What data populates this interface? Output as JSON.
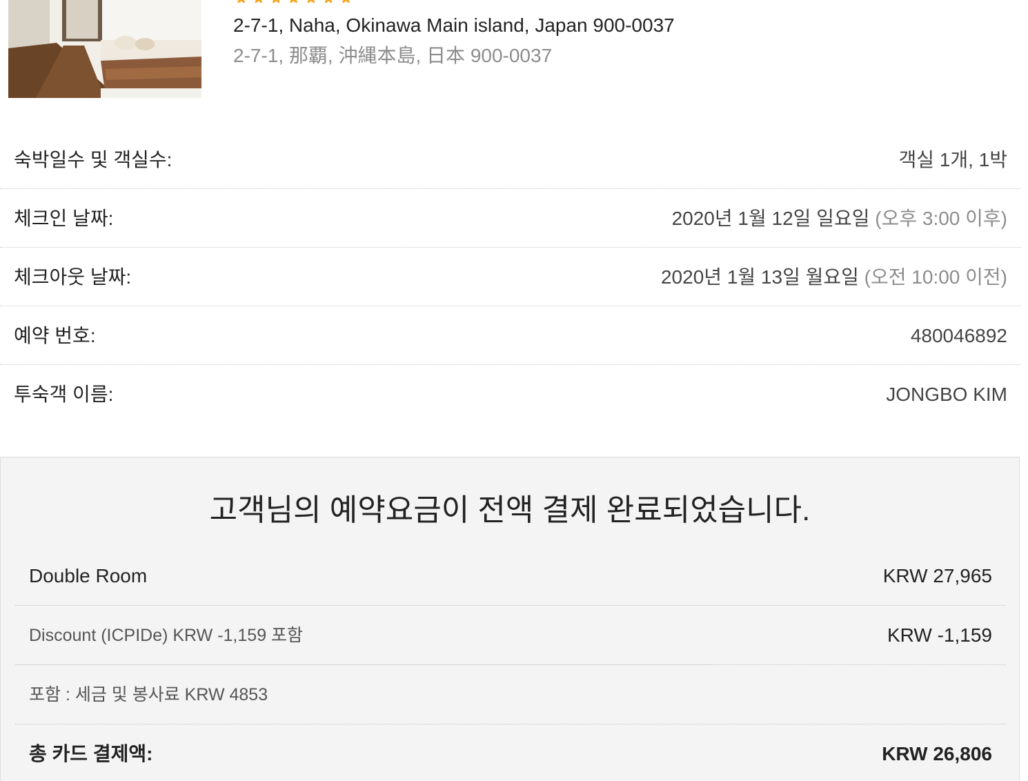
{
  "hotel": {
    "stars_display": "★★★★★★★",
    "address_en": "2-7-1, Naha, Okinawa Main island, Japan 900-0037",
    "address_local": "2-7-1, 那覇, 沖縄本島, 日本 900-0037"
  },
  "booking_details": [
    {
      "label": "숙박일수 및 객실수:",
      "value": "객실 1개, 1박",
      "note": ""
    },
    {
      "label": "체크인 날짜:",
      "value": "2020년 1월 12일 일요일",
      "note": "(오후 3:00 이후)"
    },
    {
      "label": "체크아웃 날짜:",
      "value": "2020년 1월 13일 월요일",
      "note": "(오전 10:00 이전)"
    },
    {
      "label": "예약 번호:",
      "value": "480046892",
      "note": ""
    },
    {
      "label": "투숙객 이름:",
      "value": "JONGBO KIM",
      "note": ""
    }
  ],
  "payment": {
    "title": "고객님의 예약요금이 전액 결제 완료되었습니다.",
    "room_label": "Double Room",
    "room_price": "KRW 27,965",
    "discount_label": "Discount (ICPIDe) KRW -1,159 포함",
    "discount_value": "KRW -1,159",
    "tax_label": "포함 : 세금 및 봉사료 KRW 4853",
    "total_label": "총 카드 결제액:",
    "total_value": "KRW 26,806"
  },
  "colors": {
    "star": "#f6a623",
    "text_primary": "#222222",
    "text_muted": "#8c8c8c",
    "summary_background": "#f4f4f4"
  }
}
